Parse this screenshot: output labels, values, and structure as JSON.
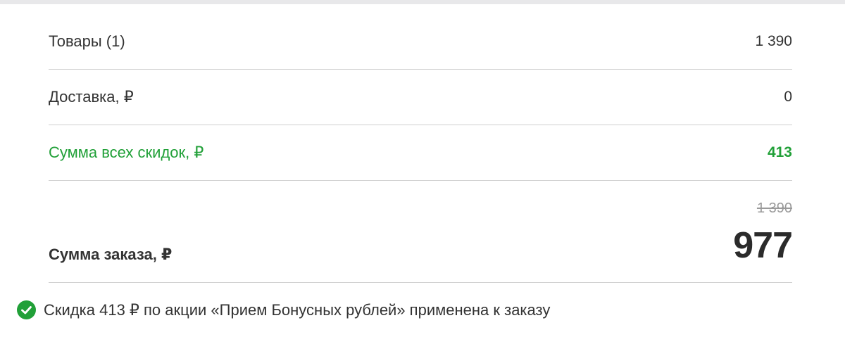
{
  "summary": {
    "items": {
      "label": "Товары (1)",
      "value": "1 390"
    },
    "delivery": {
      "label": "Доставка, ₽",
      "value": "0"
    },
    "discount": {
      "label": "Сумма всех скидок, ₽",
      "value": "413"
    },
    "total": {
      "label": "Сумма заказа, ₽",
      "old_value": "1 390",
      "value": "977"
    }
  },
  "promo": {
    "icon": "check-circle-icon",
    "text": "Скидка 413 ₽ по акции «Прием Бонусных рублей» применена к заказу"
  },
  "colors": {
    "accent_green": "#21a038",
    "divider": "#d0d0d0",
    "muted": "#9a9a9a"
  }
}
